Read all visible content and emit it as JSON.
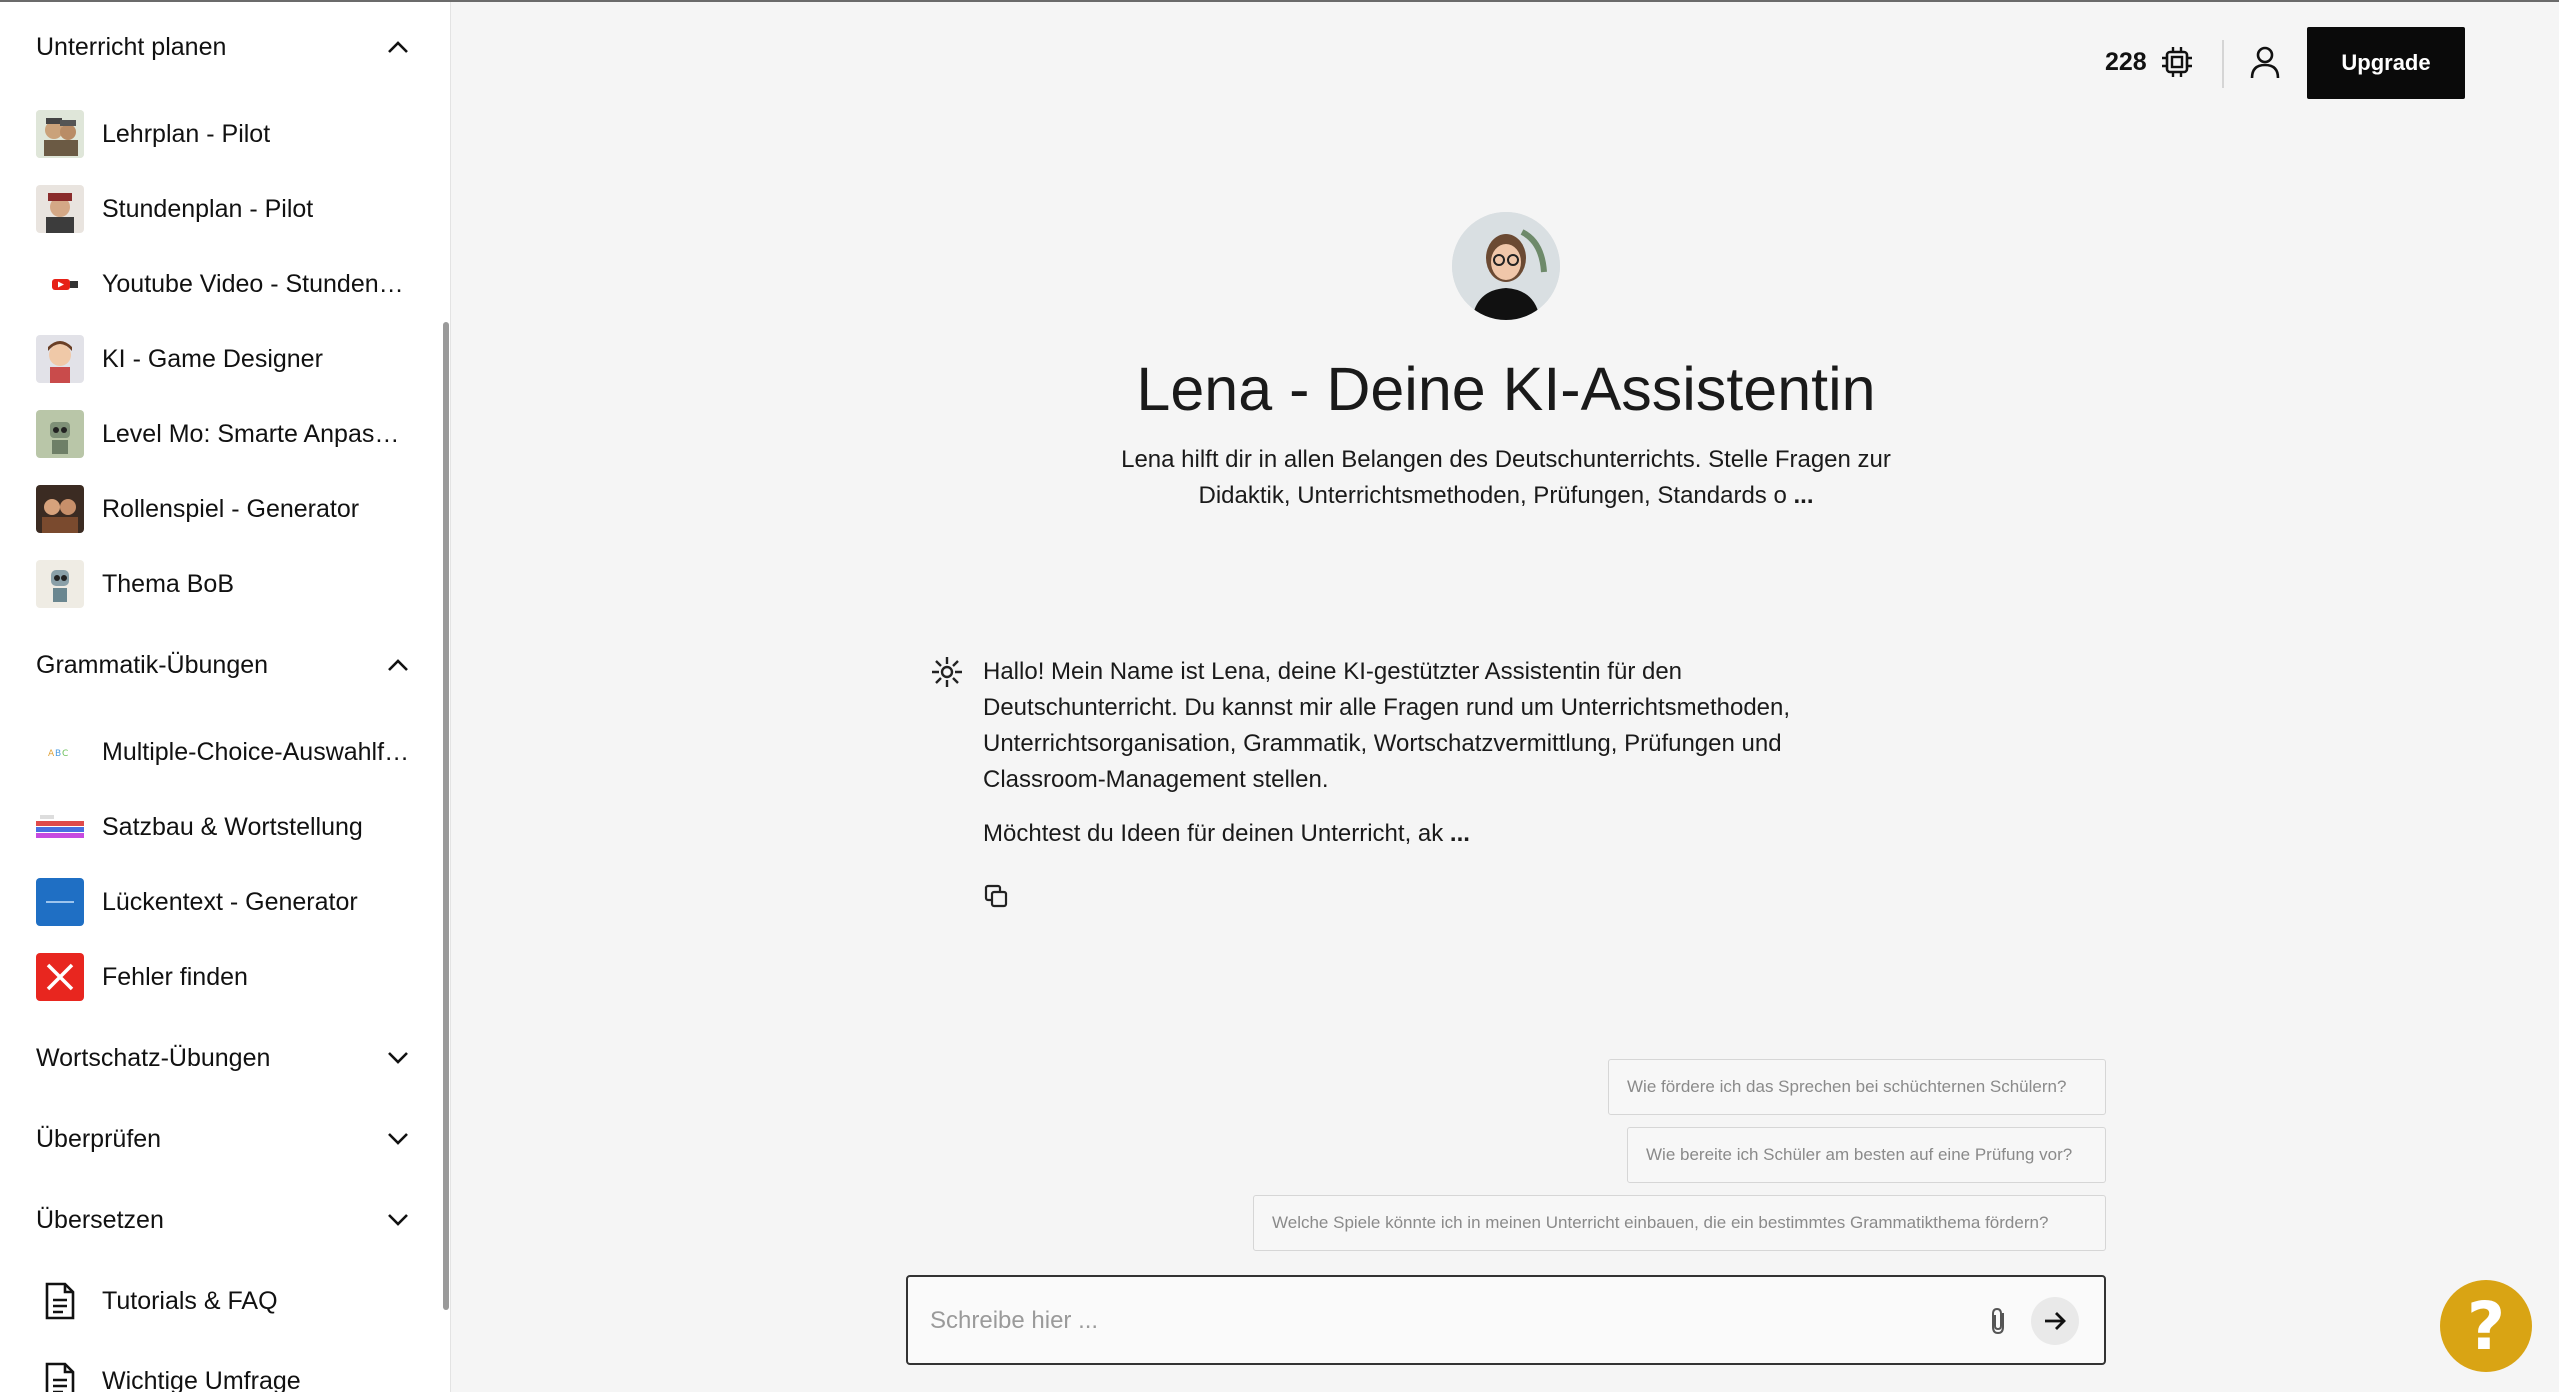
{
  "sidebar": {
    "group_plan": {
      "label": "Unterricht planen"
    },
    "plan_items": [
      {
        "label": "Lehrplan - Pilot",
        "icon": "pilot-avatar-icon"
      },
      {
        "label": "Stundenplan - Pilot",
        "icon": "pilot-avatar-icon"
      },
      {
        "label": "Youtube Video - Stundenplan",
        "icon": "youtube-icon"
      },
      {
        "label": "KI - Game Designer",
        "icon": "game-designer-avatar-icon"
      },
      {
        "label": "Level Mo: Smarte Anpassung",
        "icon": "robot-avatar-icon"
      },
      {
        "label": "Rollenspiel - Generator",
        "icon": "roleplay-avatar-icon"
      },
      {
        "label": "Thema BoB",
        "icon": "robot-avatar-icon"
      }
    ],
    "group_grammar": {
      "label": "Grammatik-Übungen"
    },
    "grammar_items": [
      {
        "label": "Multiple-Choice-Auswahlfragen",
        "icon": "abc-icon"
      },
      {
        "label": "Satzbau & Wortstellung",
        "icon": "word-blocks-icon"
      },
      {
        "label": "Lückentext - Generator",
        "icon": "gap-text-icon"
      },
      {
        "label": "Fehler finden",
        "icon": "red-x-icon"
      }
    ],
    "group_vocab": {
      "label": "Wortschatz-Übungen"
    },
    "group_review": {
      "label": "Überprüfen"
    },
    "group_translate": {
      "label": "Übersetzen"
    },
    "tutorials": {
      "label": "Tutorials & FAQ"
    },
    "survey": {
      "label": "Wichtige Umfrage"
    }
  },
  "topbar": {
    "credits": "228",
    "upgrade_label": "Upgrade"
  },
  "assistant": {
    "title": "Lena - Deine KI-Assistentin",
    "description_line1": "Lena hilft dir in allen Belangen des Deutschunterrichts. Stelle Fragen zur",
    "description_line2": "Didaktik, Unterrichtsmethoden, Prüfungen, Standards o",
    "more": " ..."
  },
  "message": {
    "paragraph1": "Hallo! Mein Name ist Lena, deine KI-gestützter Assistentin für den Deutschunterricht. Du kannst mir alle Fragen rund um Unterrichtsmethoden, Unterrichtsorganisation, Grammatik, Wortschatzvermittlung, Prüfungen und Classroom-Management stellen.",
    "paragraph2": "Möchtest du Ideen für deinen Unterricht, ak",
    "more": " ..."
  },
  "suggestions": [
    "Wie fördere ich das Sprechen bei schüchternen Schülern?",
    "Wie bereite ich Schüler am besten auf eine Prüfung vor?",
    "Welche Spiele könnte ich in meinen Unterricht einbauen, die ein bestimmtes Grammatikthema fördern?"
  ],
  "input": {
    "placeholder": "Schreibe hier ..."
  },
  "help_label": "?",
  "colors": {
    "accent_dark": "#0a0a0a",
    "help_gold": "#d9a414",
    "background": "#f5f5f5"
  }
}
